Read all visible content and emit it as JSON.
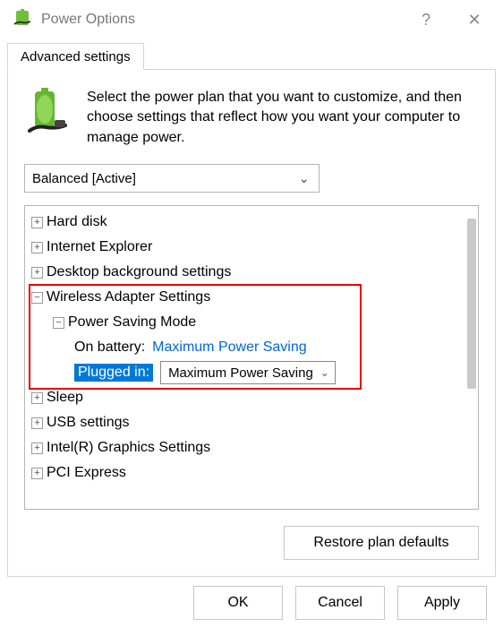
{
  "window": {
    "title": "Power Options",
    "help_glyph": "?",
    "close_glyph": "✕"
  },
  "tab": {
    "label": "Advanced settings"
  },
  "intro": "Select the power plan that you want to customize, and then choose settings that reflect how you want your computer to manage power.",
  "plan_select": {
    "value": "Balanced [Active]"
  },
  "tree": {
    "hard_disk": "Hard disk",
    "ie": "Internet Explorer",
    "desktop_bg": "Desktop background settings",
    "wireless": "Wireless Adapter Settings",
    "psm": "Power Saving Mode",
    "on_battery_label": "On battery:",
    "on_battery_value": "Maximum Power Saving",
    "plugged_label": "Plugged in:",
    "plugged_value": "Maximum Power Saving",
    "sleep": "Sleep",
    "usb": "USB settings",
    "intel_gfx": "Intel(R) Graphics Settings",
    "pci": "PCI Express"
  },
  "toggler": {
    "plus": "+",
    "minus": "−"
  },
  "chevron_down": "⌄",
  "restore_label": "Restore plan defaults",
  "buttons": {
    "ok": "OK",
    "cancel": "Cancel",
    "apply": "Apply"
  }
}
